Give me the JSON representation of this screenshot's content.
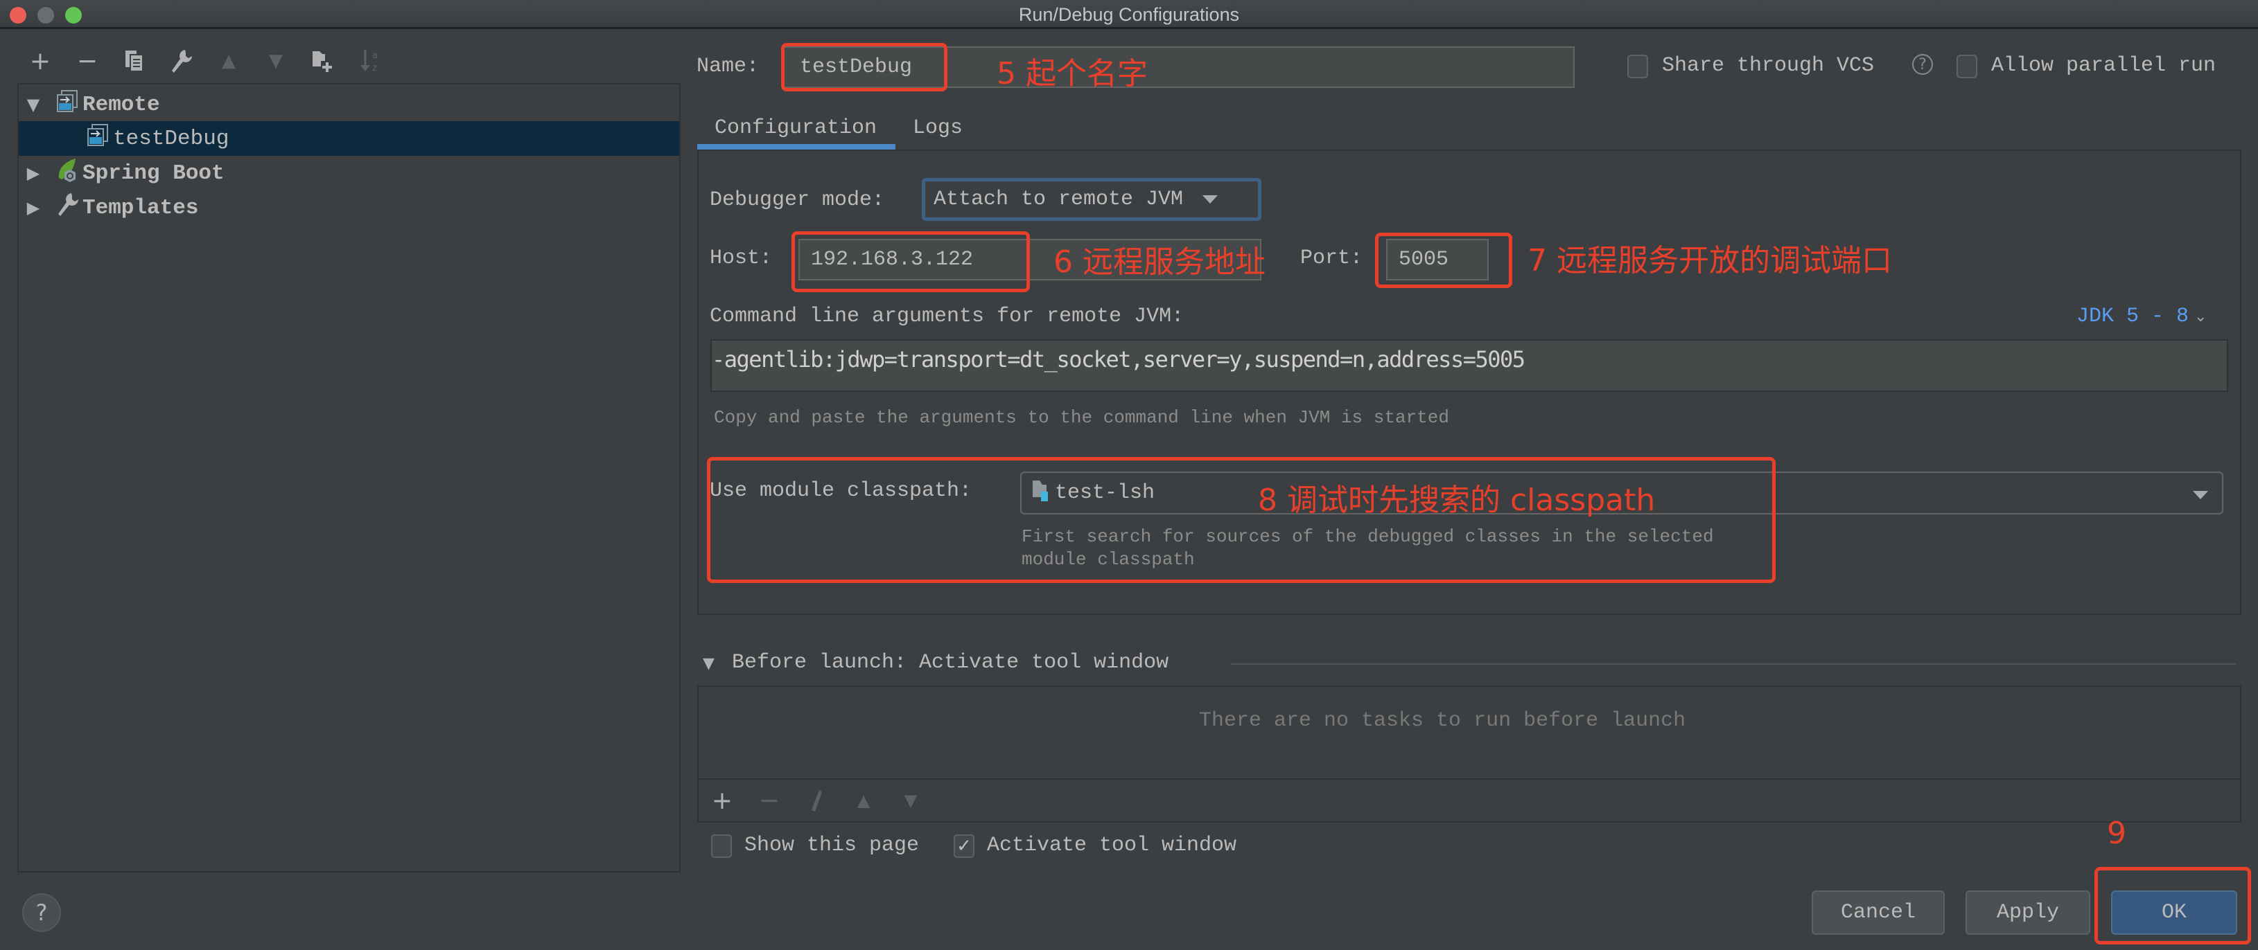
{
  "window": {
    "title": "Run/Debug Configurations",
    "traffic_lights": {
      "close": "#ec5f57",
      "minimize": "#6a6d70",
      "maximize": "#61c454"
    }
  },
  "toolbar": {
    "icons": [
      "add-icon",
      "remove-icon",
      "copy-icon",
      "wrench-icon",
      "move-up-icon",
      "move-down-icon",
      "new-folder-icon",
      "sort-alpha-icon"
    ],
    "glyphs": {
      "add": "+",
      "remove": "−",
      "up": "▲",
      "down": "▼"
    }
  },
  "tree": {
    "items": [
      {
        "label": "Remote",
        "expanded": true,
        "level": 0,
        "icon": "remote-config-icon"
      },
      {
        "label": "testDebug",
        "selected": true,
        "level": 1,
        "icon": "remote-config-icon"
      },
      {
        "label": "Spring Boot",
        "expanded": false,
        "level": 0,
        "icon": "spring-boot-icon"
      },
      {
        "label": "Templates",
        "expanded": false,
        "level": 0,
        "icon": "wrench-icon"
      }
    ],
    "arrows": {
      "expanded": "▼",
      "collapsed": "▶"
    }
  },
  "name_row": {
    "label": "Name:",
    "value": "testDebug",
    "share_vcs": {
      "label": "Share through VCS",
      "checked": false,
      "help": "?"
    },
    "allow_parallel": {
      "label": "Allow parallel run",
      "checked": false
    }
  },
  "tabs": [
    {
      "label": "Configuration",
      "active": true
    },
    {
      "label": "Logs",
      "active": false
    }
  ],
  "config": {
    "debugger_mode": {
      "label": "Debugger mode:",
      "value": "Attach to remote JVM"
    },
    "host": {
      "label": "Host:",
      "value": "192.168.3.122"
    },
    "port": {
      "label": "Port:",
      "value": "5005"
    },
    "cmd_args": {
      "label": "Command line arguments for remote JVM:",
      "jdk_selector": "JDK 5 - 8",
      "value": "-agentlib:jdwp=transport=dt_socket,server=y,suspend=n,address=5005",
      "hint": "Copy and paste the arguments to the command line when JVM is started"
    },
    "module_classpath": {
      "label": "Use module classpath:",
      "value": "test-lsh",
      "hint_line1": "First search for sources of the debugged classes in the selected",
      "hint_line2": "module classpath"
    }
  },
  "before_launch": {
    "title": "Before launch: Activate tool window",
    "empty_text": "There are no tasks to run before launch",
    "show_this_page": {
      "label": "Show this page",
      "checked": false
    },
    "activate_tool_window": {
      "label": "Activate tool window",
      "checked": true
    },
    "check_glyph": "✓"
  },
  "buttons": {
    "help": "?",
    "cancel": "Cancel",
    "apply": "Apply",
    "ok": "OK"
  },
  "annotations": {
    "color": "#e8402a",
    "a5": "5 起个名字",
    "a6": "6 远程服务地址",
    "a7": "7 远程服务开放的调试端口",
    "a8": "8 调试时先搜索的 classpath",
    "a9": "9"
  },
  "colors": {
    "background": "#3c3f41",
    "selection": "#0d293e",
    "accent_blue": "#4a88c7",
    "link_blue": "#589df6",
    "primary_button": "#365880"
  }
}
